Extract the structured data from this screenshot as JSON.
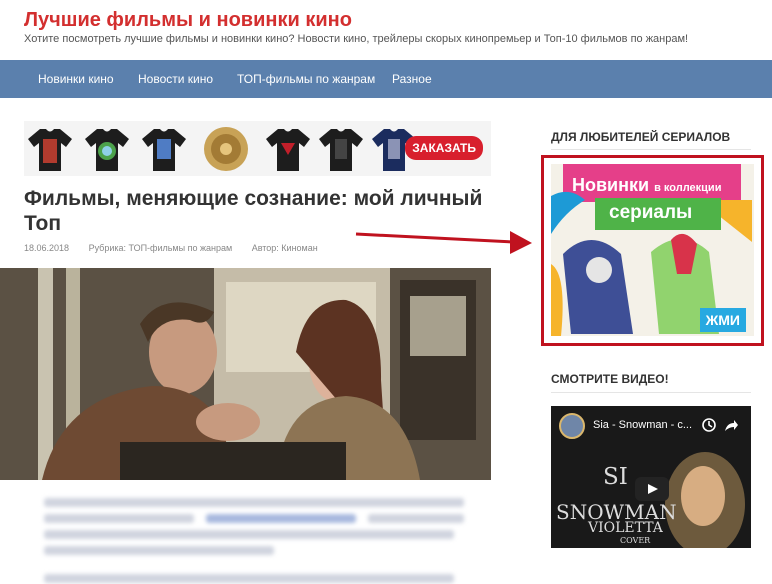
{
  "site": {
    "title": "Лучшие фильмы и новинки кино",
    "description": "Хотите посмотреть лучшие фильмы и новинки кино? Новости кино, трейлеры скорых кинопремьер и Топ-10 фильмов по жанрам!"
  },
  "nav": {
    "items": [
      "Новинки кино",
      "Новости кино",
      "ТОП-фильмы по жанрам",
      "Разное"
    ]
  },
  "ad_banner": {
    "order_label": "ЗАКАЗАТЬ"
  },
  "post": {
    "title": "Фильмы, меняющие сознание: мой личный Топ",
    "date": "18.06.2018",
    "category": "Рубрика: ТОП-фильмы по жанрам",
    "author": "Автор: Киноман"
  },
  "sidebar": {
    "series_heading": "ДЛЯ ЛЮБИТЕЛЕЙ СЕРИАЛОВ",
    "series_ad": {
      "line1_a": "Новинки",
      "line1_b": "в коллекции",
      "line2": "сериалы",
      "button": "ЖМИ"
    },
    "video_heading": "СМОТРИТЕ ВИДЕО!",
    "video": {
      "title": "Sia - Snowman - c...",
      "overlay1": "SI",
      "overlay2": "SNOWMAN",
      "overlay3": "VIOLETTA",
      "overlay4": "COVER"
    }
  },
  "colors": {
    "site_title": "#d32f2f",
    "nav_bg": "#5b80ad",
    "ad_border": "#c0121f",
    "order_button": "#d81f2d",
    "press_button": "#27a9e1"
  },
  "icons": [
    "clock-icon",
    "share-icon",
    "play-icon",
    "arrow-right-icon"
  ]
}
